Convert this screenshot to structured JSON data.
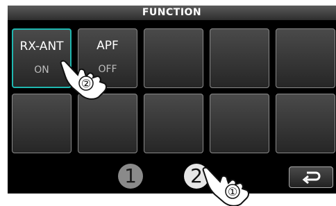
{
  "header": {
    "title": "FUNCTION"
  },
  "functions": [
    {
      "name": "RX-ANT",
      "state": "ON"
    },
    {
      "name": "APF",
      "state": "OFF"
    },
    {
      "name": "",
      "state": ""
    },
    {
      "name": "",
      "state": ""
    },
    {
      "name": "",
      "state": ""
    },
    {
      "name": "",
      "state": ""
    },
    {
      "name": "",
      "state": ""
    },
    {
      "name": "",
      "state": ""
    },
    {
      "name": "",
      "state": ""
    },
    {
      "name": "",
      "state": ""
    }
  ],
  "pages": {
    "page1": "1",
    "page2": "2"
  },
  "callouts": {
    "step1": "①",
    "step2": "②"
  },
  "icons": {
    "back": "return-arrow-icon",
    "hand": "pointing-hand-icon"
  },
  "colors": {
    "active_border": "#1fb7b0",
    "screen_bg": "#000000"
  }
}
